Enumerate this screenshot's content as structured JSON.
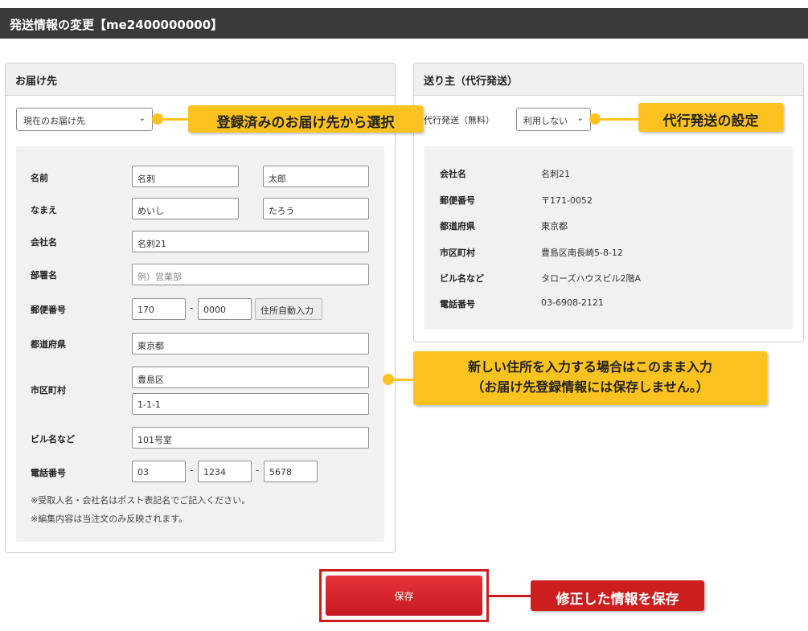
{
  "header": {
    "title": "発送情報の変更【me2400000000】"
  },
  "recipient_panel": {
    "title": "お届け先",
    "address_select": {
      "value": "現在のお届け先"
    },
    "labels": {
      "name": "名前",
      "kana": "なまえ",
      "company": "会社名",
      "department": "部署名",
      "postal": "郵便番号",
      "prefecture": "都道府県",
      "city": "市区町村",
      "building": "ビル名など",
      "phone": "電話番号"
    },
    "fields": {
      "last_name": "名刺",
      "first_name": "太郎",
      "last_kana": "めいし",
      "first_kana": "たろう",
      "company": "名刺21",
      "department_placeholder": "例）営業部",
      "postal1": "170",
      "postal2": "0000",
      "prefecture": "東京都",
      "city1": "豊島区",
      "city2": "1-1-1",
      "building": "101号室",
      "phone1": "03",
      "phone2": "1234",
      "phone3": "5678"
    },
    "auto_address_button": "住所自動入力",
    "dash": "-",
    "notes": [
      "※受取人名・会社名はポスト表記名でご記入ください。",
      "※編集内容は当注文のみ反映されます。"
    ]
  },
  "sender_panel": {
    "title": "送り主（代行発送）",
    "proxy_label": "代行発送（無料）",
    "proxy_select": {
      "value": "利用しない"
    },
    "rows": [
      {
        "label": "会社名",
        "value": "名刺21"
      },
      {
        "label": "郵便番号",
        "value": "〒171-0052"
      },
      {
        "label": "都道府県",
        "value": "東京都"
      },
      {
        "label": "市区町村",
        "value": "豊島区南長崎5-8-12"
      },
      {
        "label": "ビル名など",
        "value": "タローズハウスビル2階A"
      },
      {
        "label": "電話番号",
        "value": "03-6908-2121"
      }
    ]
  },
  "callouts": {
    "select_saved": "登録済みのお届け先から選択",
    "proxy_settings": "代行発送の設定",
    "new_address_line1": "新しい住所を入力する場合はこのまま入力",
    "new_address_line2": "（お届け先登録情報には保存しません。）",
    "save_info": "修正した情報を保存"
  },
  "save_button": "保存",
  "colors": {
    "accent_yellow": "#fcc21f",
    "accent_red": "#cc1e1e",
    "header_bg": "#3a3a3a"
  }
}
